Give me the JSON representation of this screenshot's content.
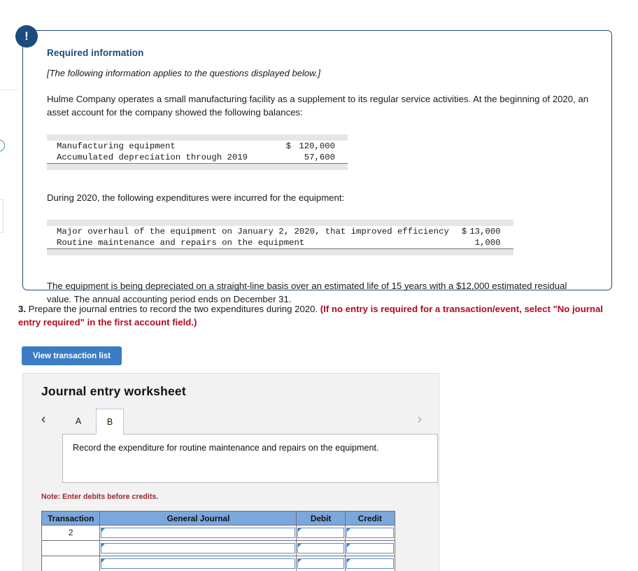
{
  "alert": {
    "icon": "exclamation-icon",
    "glyph": "!"
  },
  "info_card": {
    "heading": "Required information",
    "applies_note": "[The following information applies to the questions displayed below.]",
    "intro_paragraph": "Hulme Company operates a small manufacturing facility as a supplement to its regular service activities. At the beginning of 2020, an asset account for the company showed the following balances:",
    "balances_table": {
      "rows": [
        {
          "label": "Manufacturing equipment",
          "currency": "$",
          "amount": "120,000"
        },
        {
          "label": "Accumulated depreciation through 2019",
          "currency": "",
          "amount": "57,600"
        }
      ]
    },
    "mid_paragraph": "During 2020, the following expenditures were incurred for the equipment:",
    "expenditures_table": {
      "rows": [
        {
          "label": "Major overhaul of the equipment on January 2, 2020, that improved efficiency",
          "currency": "$",
          "amount": "13,000"
        },
        {
          "label": "Routine maintenance and repairs on the equipment",
          "currency": "",
          "amount": "1,000"
        }
      ]
    },
    "closing_paragraph": "The equipment is being depreciated on a straight-line basis over an estimated life of 15 years with a $12,000 estimated residual value. The annual accounting period ends on December 31."
  },
  "question": {
    "number": "3.",
    "text": " Prepare the journal entries to record the two expenditures during 2020. ",
    "emphasis": "(If no entry is required for a transaction/event, select \"No journal entry required\" in the first account field.)"
  },
  "toolbar": {
    "view_transaction_list_label": "View transaction list"
  },
  "worksheet": {
    "title": "Journal entry worksheet",
    "prev_arrow": "‹",
    "next_arrow": "›",
    "tabs": [
      {
        "label": "A",
        "selected": false
      },
      {
        "label": "B",
        "selected": true
      }
    ],
    "prompt": "Record the expenditure for routine maintenance and repairs on the equipment.",
    "note": "Note: Enter debits before credits.",
    "journal_table": {
      "headers": [
        "Transaction",
        "General Journal",
        "Debit",
        "Credit"
      ],
      "rows": [
        {
          "transaction": "2",
          "general_journal": "",
          "debit": "",
          "credit": ""
        },
        {
          "transaction": "",
          "general_journal": "",
          "debit": "",
          "credit": ""
        },
        {
          "transaction": "",
          "general_journal": "",
          "debit": "",
          "credit": ""
        }
      ]
    }
  },
  "colors": {
    "card_border": "#1c4b7e",
    "badge": "#1c4b7e",
    "button": "#3b7dc4",
    "table_header": "#7ba7dd",
    "warning_text": "#b40a1e",
    "note_text": "#9e2a2a"
  }
}
